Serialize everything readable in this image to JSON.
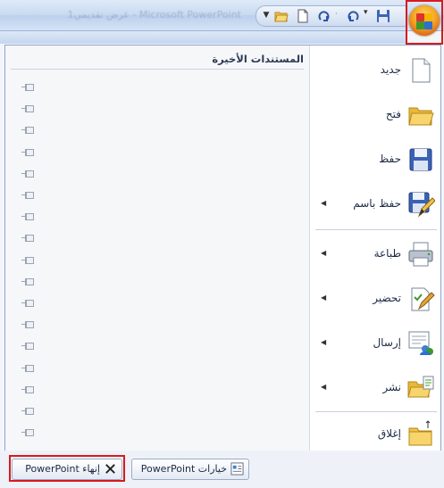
{
  "window": {
    "title": "Microsoft PowerPoint - عرض تقديمي1"
  },
  "office_button": {
    "icon": "office-logo-icon"
  },
  "quick_access": {
    "icons": [
      "save-icon",
      "undo-icon",
      "redo-icon",
      "new-doc-icon",
      "open-folder-icon",
      "customize-dropdown-icon"
    ]
  },
  "recent": {
    "heading": "المستندات الأخيرة",
    "pin_count": 17,
    "pin_icon": "pin-icon"
  },
  "commands": [
    {
      "id": "new",
      "label": "جديد",
      "icon": "new-document-icon",
      "has_submenu": false
    },
    {
      "id": "open",
      "label": "فتح",
      "icon": "open-folder-icon",
      "has_submenu": false
    },
    {
      "id": "save",
      "label": "حفظ",
      "icon": "save-disk-icon",
      "has_submenu": false
    },
    {
      "id": "save-as",
      "label": "حفظ باسم",
      "icon": "save-as-icon",
      "has_submenu": true
    },
    {
      "id": "print",
      "label": "طباعة",
      "icon": "printer-icon",
      "has_submenu": true
    },
    {
      "id": "prepare",
      "label": "تحضير",
      "icon": "prepare-icon",
      "has_submenu": true
    },
    {
      "id": "send",
      "label": "إرسال",
      "icon": "send-icon",
      "has_submenu": true
    },
    {
      "id": "publish",
      "label": "نشر",
      "icon": "publish-icon",
      "has_submenu": true
    },
    {
      "id": "close",
      "label": "إغلاق",
      "icon": "close-folder-icon",
      "has_submenu": false
    }
  ],
  "footer": {
    "options_label": "خيارات PowerPoint",
    "options_icon": "options-icon",
    "exit_label": "إنهاء PowerPoint",
    "exit_icon": "close-x-icon"
  },
  "colors": {
    "highlight": "#d8191d",
    "menu_border": "#8ea6cc",
    "titlebar": "#c9daf0"
  }
}
